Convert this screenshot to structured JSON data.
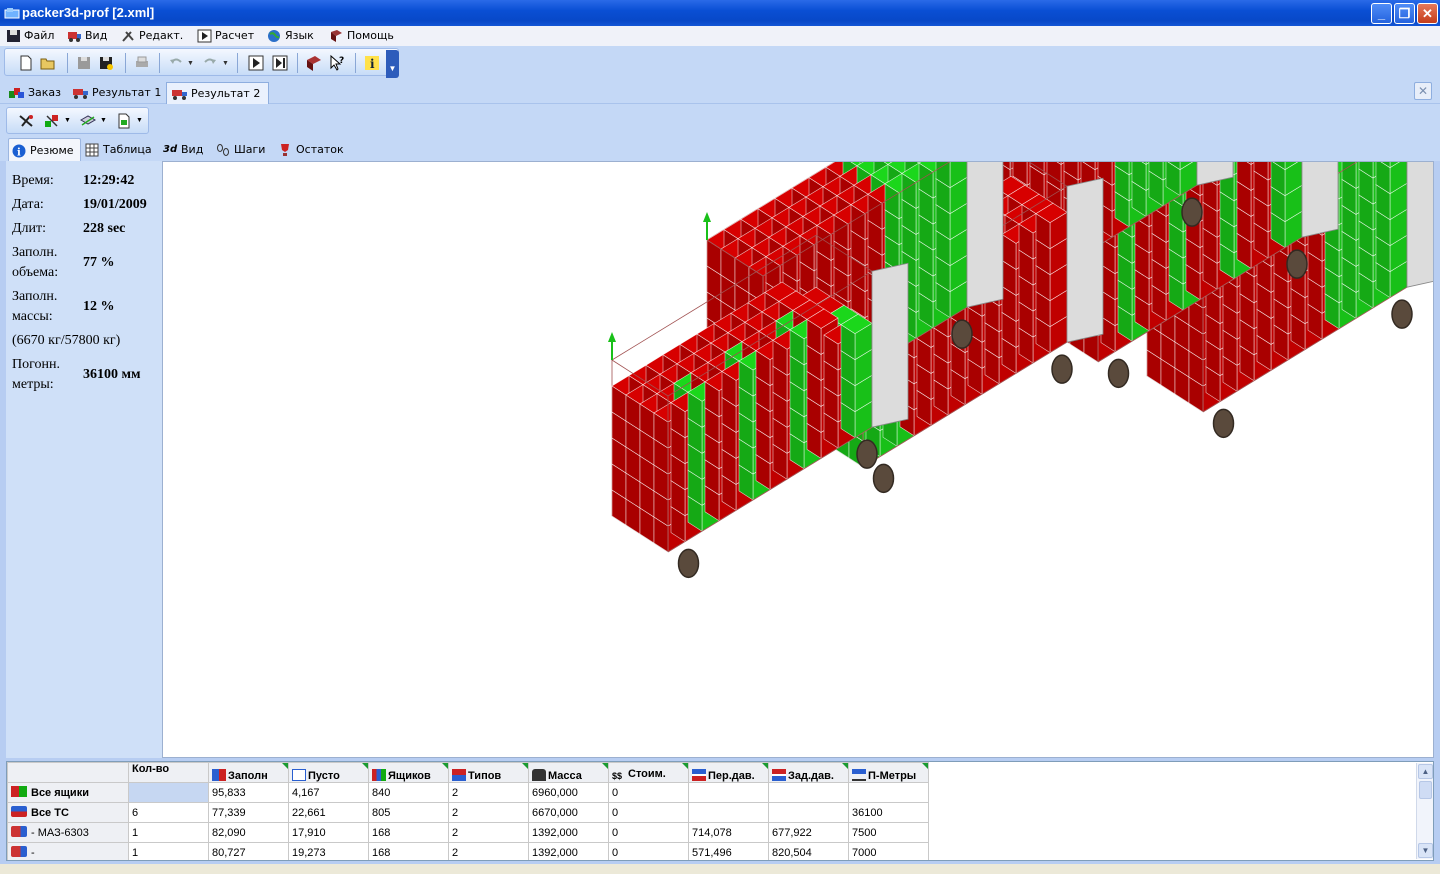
{
  "window": {
    "title": "packer3d-prof [2.xml]"
  },
  "menu": {
    "file": "Файл",
    "view": "Вид",
    "edit": "Редакт.",
    "calc": "Расчет",
    "lang": "Язык",
    "help": "Помощь"
  },
  "doc_tabs": {
    "order": "Заказ",
    "result1": "Результат 1",
    "result2": "Результат 2"
  },
  "view_tabs": {
    "summary": "Резюме",
    "table": "Таблица",
    "view3d": "Вид",
    "steps": "Шаги",
    "remainder": "Остаток"
  },
  "summary": {
    "time_label": "Время:",
    "time_value": "12:29:42",
    "date_label": "Дата:",
    "date_value": "19/01/2009",
    "duration_label": "Длит:",
    "duration_value": "228 sec",
    "vol_label_1": "Заполн.",
    "vol_label_2": "объема:",
    "vol_value": "77 %",
    "mass_label_1": "Заполн.",
    "mass_label_2": "массы:",
    "mass_value": "12 %",
    "mass_detail": "(6670 кг/57800 кг)",
    "meters_label_1": "Погонн.",
    "meters_label_2": "метры:",
    "meters_value": "36100 мм"
  },
  "grid": {
    "headers": [
      "Кол-во",
      "Заполн",
      "Пусто",
      "Ящиков",
      "Типов",
      "Масса",
      "Стоим.",
      "Пер.дав.",
      "Зад.дав.",
      "П-Метры"
    ],
    "rows": [
      {
        "label": "Все ящики",
        "cells": [
          "",
          "95,833",
          "4,167",
          "840",
          "2",
          "6960,000",
          "0",
          "",
          "",
          ""
        ]
      },
      {
        "label": "Все ТС",
        "cells": [
          "6",
          "77,339",
          "22,661",
          "805",
          "2",
          "6670,000",
          "0",
          "",
          "",
          "36100"
        ]
      },
      {
        "label": "- МАЗ-6303",
        "cells": [
          "1",
          "82,090",
          "17,910",
          "168",
          "2",
          "1392,000",
          "0",
          "714,078",
          "677,922",
          "7500"
        ]
      },
      {
        "label": "-",
        "cells": [
          "1",
          "80,727",
          "19,273",
          "168",
          "2",
          "1392,000",
          "0",
          "571,496",
          "820,504",
          "7000"
        ]
      }
    ]
  },
  "colors": {
    "crate_red": "#c00000",
    "crate_green": "#18c018",
    "accent": "#0a4fd4"
  }
}
